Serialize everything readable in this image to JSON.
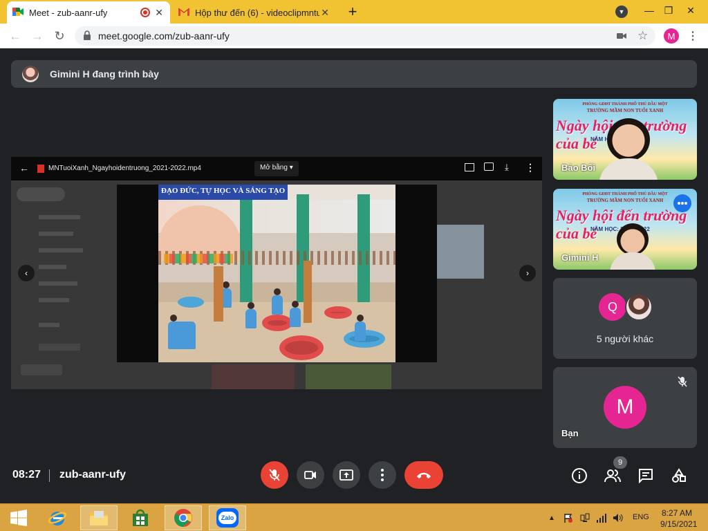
{
  "browser": {
    "tabs": [
      {
        "title": "Meet - zub-aanr-ufy",
        "icon": "google-meet-icon",
        "recording": true
      },
      {
        "title": "Hộp thư đến (6) - videoclipmntuo",
        "icon": "gmail-icon"
      }
    ],
    "new_tab": "+",
    "url": "meet.google.com/zub-aanr-ufy",
    "profile_initial": "M"
  },
  "meet": {
    "presenter_banner": "Gimini H đang trình bày",
    "shared_screen": {
      "file_name": "MNTuoiXanh_Ngayhoidentruong_2021-2022.mp4",
      "open_with": "Mở bằng",
      "video_caption": "ĐẠO ĐỨC, TỰ HỌC VÀ SÁNG TẠO"
    },
    "tiles": [
      {
        "name": "Bảo Bối",
        "poster_school": "PHÒNG GDĐT THÀNH PHỐ THỦ DẦU MỘT",
        "poster_school2": "TRƯỜNG MẦM NON TUỔI XANH",
        "poster_title": "Ngày hội đến trường của bé",
        "poster_year": "NĂM HỌC: 2021 - 2022"
      },
      {
        "name": "Gimini H",
        "poster_school": "PHÒNG GDĐT THÀNH PHỐ THỦ DẦU MỘT",
        "poster_school2": "TRƯỜNG MẦM NON TUỔI XANH",
        "poster_title": "Ngày hội đến trường của bé",
        "poster_year": "NĂM HỌC: 2021 - 2022"
      },
      {
        "avatar_initial": "Q",
        "label": "5 người khác"
      },
      {
        "avatar_initial": "M",
        "name": "Bạn"
      }
    ],
    "time": "08:27",
    "meeting_code": "zub-aanr-ufy",
    "people_count": "9",
    "colors": {
      "end_call": "#ea4335",
      "avatar": "#e52592",
      "speaking": "#1a73e8"
    }
  },
  "taskbar": {
    "language": "ENG",
    "time": "8:27 AM",
    "date": "9/15/2021",
    "apps": [
      "start-button",
      "internet-explorer",
      "file-explorer",
      "microsoft-store",
      "chrome",
      "zalo"
    ],
    "zalo_label": "Zalo"
  }
}
